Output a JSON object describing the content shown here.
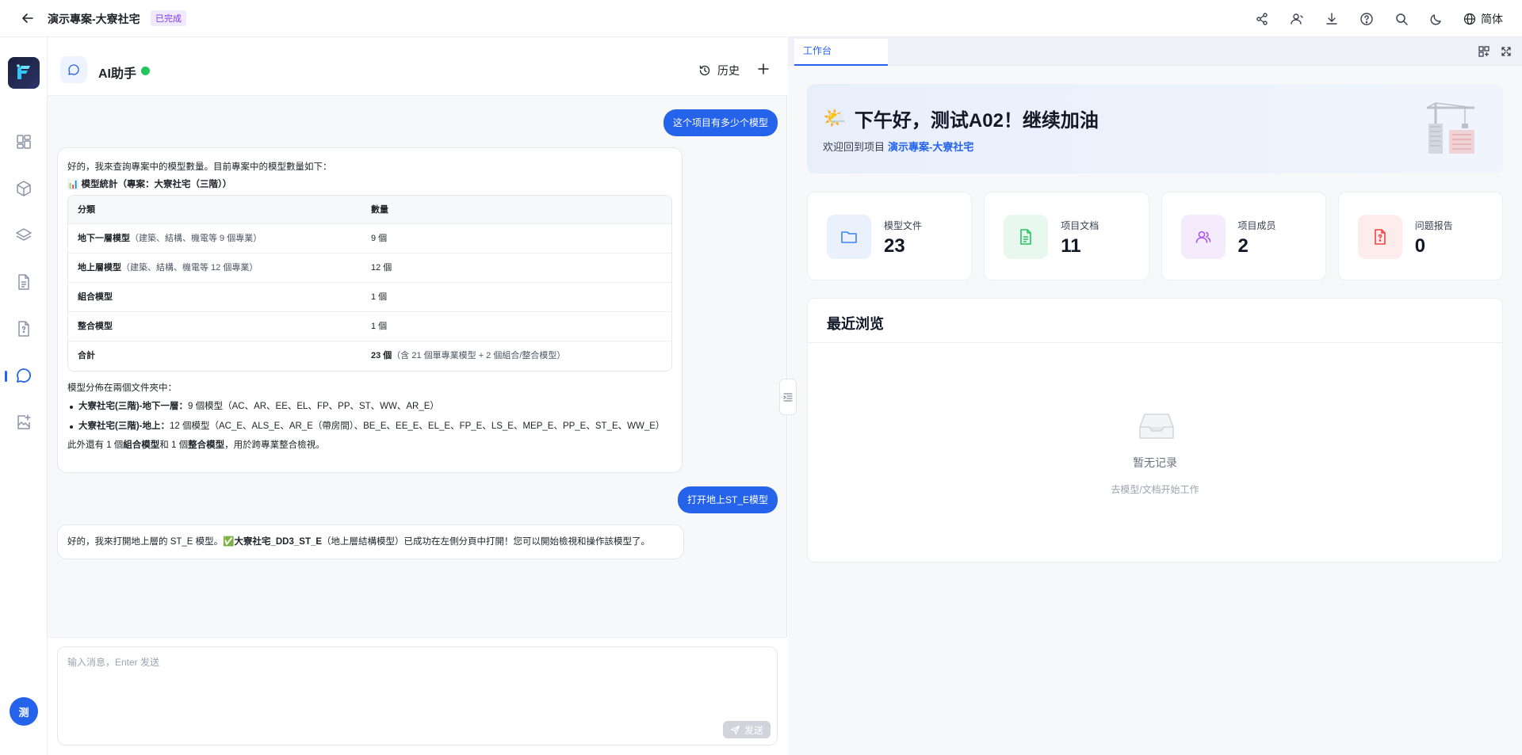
{
  "topbar": {
    "project_title": "演示專案-大寮社宅",
    "status_badge": "已完成",
    "language": "简体",
    "icons": [
      "share-icon",
      "members-icon",
      "download-icon",
      "help-icon",
      "search-icon",
      "dark-mode-icon",
      "globe-icon"
    ]
  },
  "rail": {
    "items": [
      "dashboard-icon",
      "model-cube-icon",
      "layers-icon",
      "document-icon",
      "issue-report-icon",
      "ai-chat-icon",
      "image-edit-icon"
    ],
    "active": "ai-chat-icon",
    "user_initial": "测"
  },
  "chat": {
    "title": "AI助手",
    "history_label": "历史",
    "messages": {
      "user1": "这个项目有多少个模型",
      "ai1": {
        "intro": "好的，我來查詢專案中的模型數量。目前專案中的模型數量如下：",
        "stats_heading": "📊 模型統計（專案：大寮社宅（三階））",
        "table": {
          "headers": [
            "分類",
            "數量"
          ],
          "rows": [
            {
              "category": "地下一層模型",
              "note": "（建築、結構、機電等 9 個專業）",
              "count": "9 個",
              "count_note": ""
            },
            {
              "category": "地上層模型",
              "note": "（建築、結構、機電等 12 個專業）",
              "count": "12 個",
              "count_note": ""
            },
            {
              "category": "組合模型",
              "note": "",
              "count": "1 個",
              "count_note": ""
            },
            {
              "category": "整合模型",
              "note": "",
              "count": "1 個",
              "count_note": ""
            },
            {
              "category": "合計",
              "note": "",
              "count": "23 個",
              "count_note": "（含 21 個單專業模型 + 2 個組合/整合模型）"
            }
          ]
        },
        "distribution_heading": "模型分佈在兩個文件夾中：",
        "distribution": [
          {
            "folder": "大寮社宅(三階)-地下一層：",
            "detail": "9 個模型（AC、AR、EE、EL、FP、PP、ST、WW、AR_E）"
          },
          {
            "folder": "大寮社宅(三階)-地上：",
            "detail": "12 個模型（AC_E、ALS_E、AR_E（帶房間）、BE_E、EE_E、EL_E、FP_E、LS_E、MEP_E、PP_E、ST_E、WW_E）"
          }
        ],
        "footer_parts": [
          "此外還有 1 個",
          "組合模型",
          "和 1 個",
          "整合模型",
          "，用於跨專業整合檢視。"
        ]
      },
      "user2": "打开地上ST_E模型",
      "ai2": {
        "part1": "好的，我來打開地上層的 ST_E 模型。",
        "check": "✅",
        "model_name": "大寮社宅_DD3_ST_E",
        "part2": "（地上層結構模型）已成功在左側分頁中打開！您可以開始檢視和操作該模型了。"
      }
    },
    "input": {
      "placeholder": "输入消息，Enter 发送",
      "value": "",
      "send_label": "发送"
    }
  },
  "workbench": {
    "tab_label": "工作台",
    "greeting": {
      "emoji": "🌤️",
      "title": "下午好，测试A02！继续加油",
      "welcome_prefix": "欢迎回到项目",
      "project_name": "演示專案-大寮社宅"
    },
    "stats": [
      {
        "label": "模型文件",
        "value": "23",
        "icon": "folder-icon",
        "color": "#3b82f6",
        "bg": "#eaf1fd"
      },
      {
        "label": "项目文档",
        "value": "11",
        "icon": "document-icon",
        "color": "#22c55e",
        "bg": "#e9f8ef"
      },
      {
        "label": "项目成员",
        "value": "2",
        "icon": "members-icon",
        "color": "#a855f7",
        "bg": "#f4ecfd"
      },
      {
        "label": "问题报告",
        "value": "0",
        "icon": "issue-report-icon",
        "color": "#ef4444",
        "bg": "#fdecec"
      }
    ],
    "recent": {
      "title": "最近浏览",
      "empty_text": "暂无记录",
      "empty_hint": "去模型/文档开始工作"
    }
  },
  "colors": {
    "accent": "#2563eb",
    "online": "#22c55e"
  }
}
